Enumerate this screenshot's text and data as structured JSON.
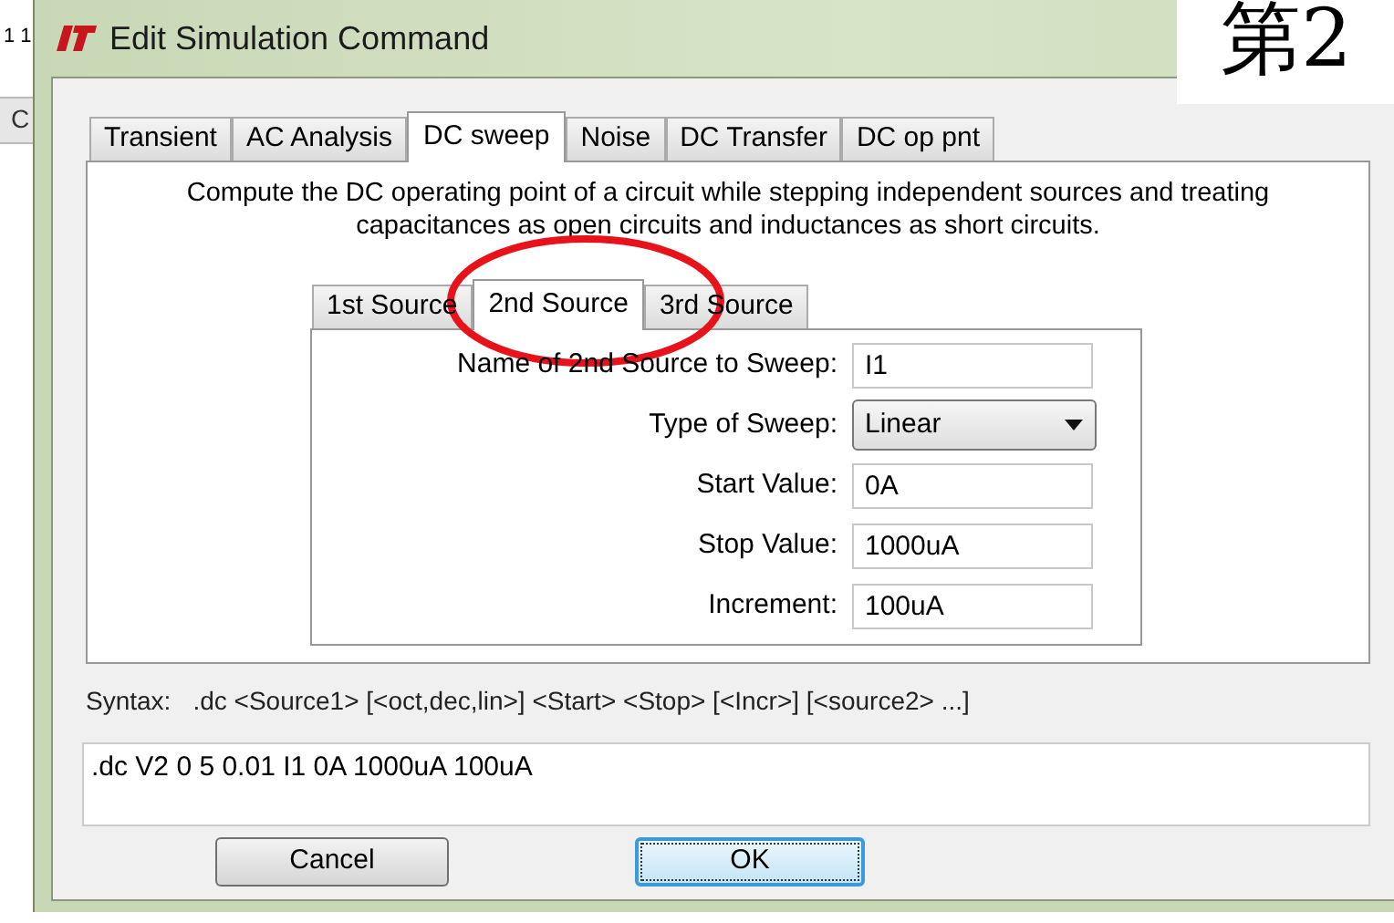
{
  "background": {
    "texts": [
      "1 1",
      "C"
    ]
  },
  "overlay_text": "第2",
  "window": {
    "title": "Edit Simulation Command"
  },
  "tabs": [
    {
      "label": "Transient",
      "selected": false
    },
    {
      "label": "AC Analysis",
      "selected": false
    },
    {
      "label": "DC sweep",
      "selected": true
    },
    {
      "label": "Noise",
      "selected": false
    },
    {
      "label": "DC Transfer",
      "selected": false
    },
    {
      "label": "DC op pnt",
      "selected": false
    }
  ],
  "description": "Compute the DC operating point of a circuit while stepping independent sources and treating capacitances as open circuits and inductances as short circuits.",
  "source_tabs": [
    {
      "label": "1st Source",
      "selected": false
    },
    {
      "label": "2nd Source",
      "selected": true
    },
    {
      "label": "3rd Source",
      "selected": false
    }
  ],
  "fields": [
    {
      "kind": "text",
      "label": "Name of 2nd Source to Sweep:",
      "value": "I1"
    },
    {
      "kind": "dropdown",
      "label": "Type of Sweep:",
      "value": "Linear"
    },
    {
      "kind": "text",
      "label": "Start Value:",
      "value": "0A"
    },
    {
      "kind": "text",
      "label": "Stop Value:",
      "value": "1000uA"
    },
    {
      "kind": "text",
      "label": "Increment:",
      "value": "100uA"
    }
  ],
  "syntax": {
    "label": "Syntax:",
    "text": ".dc <Source1> [<oct,dec,lin>] <Start> <Stop> [<Incr>] [<source2> ...]"
  },
  "command": ".dc V2 0 5 0.01 I1 0A 1000uA 100uA",
  "buttons": [
    {
      "label": "Cancel",
      "default": false
    },
    {
      "label": "OK",
      "default": true
    }
  ]
}
